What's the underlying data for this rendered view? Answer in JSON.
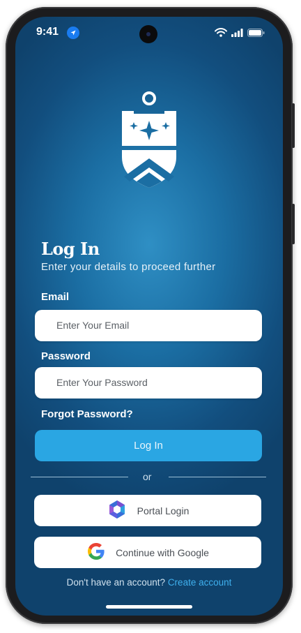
{
  "status_bar": {
    "time": "9:41"
  },
  "auth": {
    "title": "Log In",
    "subtitle": "Enter your details to proceed further",
    "email_label": "Email",
    "email_placeholder": "Enter Your Email",
    "password_label": "Password",
    "password_placeholder": "Enter Your Password",
    "forgot_label": "Forgot Password?",
    "login_button": "Log In",
    "divider_text": "or",
    "portal_button": "Portal Login",
    "google_button": "Continue with Google",
    "signup_prompt": "Don't have an account?",
    "signup_link": "Create account"
  },
  "icons": {
    "location": "location-arrow-icon",
    "wifi": "wifi-icon",
    "cellular": "cellular-signal-icon",
    "battery": "battery-icon",
    "logo": "shield-crest-logo",
    "portal": "microsoft-portal-icon",
    "google": "google-g-icon"
  },
  "colors": {
    "background_top": "#124e7e",
    "background_glow": "#2f8fc4",
    "primary_button": "#2aa6e3",
    "link": "#3fb0ee",
    "input_bg": "#ffffff"
  }
}
